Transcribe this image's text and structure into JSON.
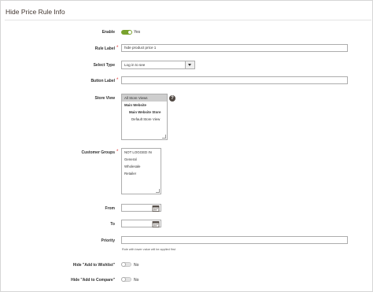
{
  "section": {
    "title": "Hide Price Rule Info"
  },
  "enable": {
    "label": "Enable",
    "state": "Yes",
    "on": true
  },
  "rule_label": {
    "label": "Rule Label",
    "value": "hide product price 1"
  },
  "select_type": {
    "label": "Select Type",
    "value": "Log in to see"
  },
  "button_label": {
    "label": "Button Label",
    "value": ""
  },
  "store_view": {
    "label": "Store View",
    "options": {
      "all": "All Store Views",
      "website": "Main Website",
      "store": "Main Website Store",
      "default": "Default Store View"
    },
    "help": "?"
  },
  "customer_groups": {
    "label": "Customer Groups",
    "options": [
      "NOT LOGGED IN",
      "General",
      "Wholesale",
      "Retailer"
    ]
  },
  "from": {
    "label": "From",
    "value": ""
  },
  "to": {
    "label": "To",
    "value": ""
  },
  "priority": {
    "label": "Priority",
    "value": "",
    "note": "Rule with lower value will be applied first"
  },
  "hide_wishlist": {
    "label": "Hide \"Add to Wishlist\"",
    "state": "No",
    "on": false
  },
  "hide_compare": {
    "label": "Hide \"Add to Compare\"",
    "state": "No",
    "on": false
  },
  "required_mark": "*",
  "colors": {
    "toggle_on": "#79a22e",
    "required": "#e22626",
    "selected_option": "#cecece"
  }
}
